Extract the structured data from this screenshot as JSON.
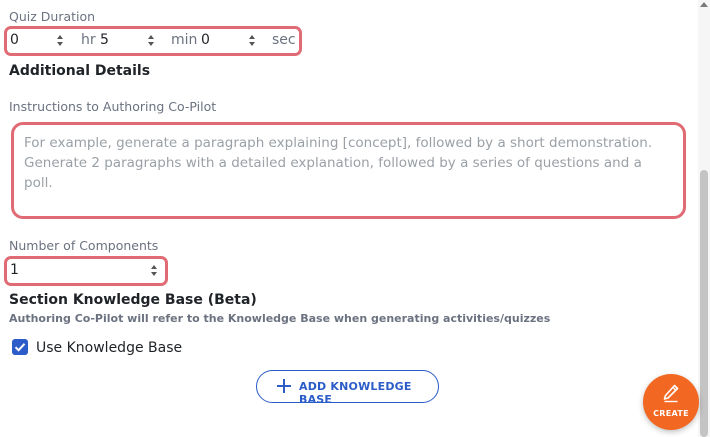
{
  "quiz_duration": {
    "label": "Quiz Duration",
    "hours_value": "0",
    "hours_unit": "hr",
    "minutes_value": "5",
    "minutes_unit": "min",
    "seconds_value": "0",
    "seconds_unit": "sec"
  },
  "additional_details": {
    "heading": "Additional Details",
    "instructions_label": "Instructions to Authoring Co-Pilot",
    "instructions_placeholder": "For example, generate a paragraph explaining [concept], followed by a short demonstration. Generate 2 paragraphs with a detailed explanation, followed by a series of questions and a poll."
  },
  "components": {
    "label": "Number of Components",
    "value": "1"
  },
  "knowledge_base": {
    "heading": "Section Knowledge Base (Beta)",
    "note": "Authoring Co-Pilot will refer to the Knowledge Base when generating activities/quizzes",
    "checkbox_label": "Use Knowledge Base",
    "checkbox_checked": true,
    "add_button_label": "ADD KNOWLEDGE BASE"
  },
  "fab": {
    "label": "CREATE",
    "icon": "pencil-icon",
    "color": "#f26722"
  },
  "colors": {
    "highlight": "#e06b74",
    "accent": "#2b5cc8"
  }
}
